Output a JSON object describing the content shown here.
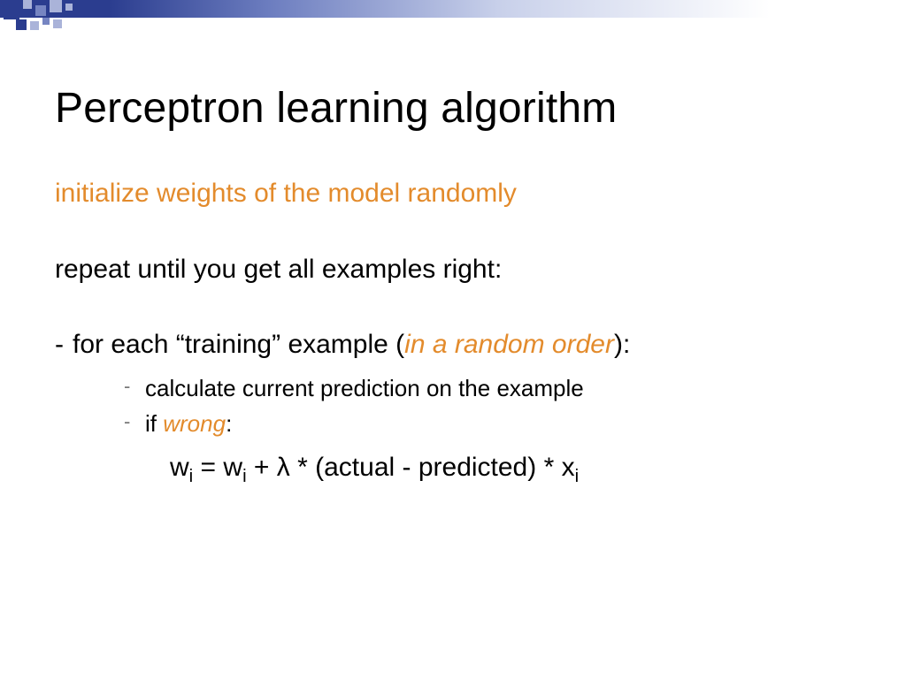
{
  "title": "Perceptron learning algorithm",
  "line_init": "initialize weights of the model randomly",
  "line_repeat": "repeat until you get all examples right:",
  "bullet_dash": "-",
  "for_each_pre": "for each “training” example (",
  "for_each_orange": "in a random order",
  "for_each_post": "):",
  "sub1": "calculate current prediction on the example",
  "sub2_pre": "if ",
  "sub2_orange": "wrong",
  "sub2_post": ":",
  "formula": {
    "a": "w",
    "b": "i",
    "c": " = w",
    "d": "i",
    "e": " + λ * (actual - predicted) * x",
    "f": "i"
  }
}
